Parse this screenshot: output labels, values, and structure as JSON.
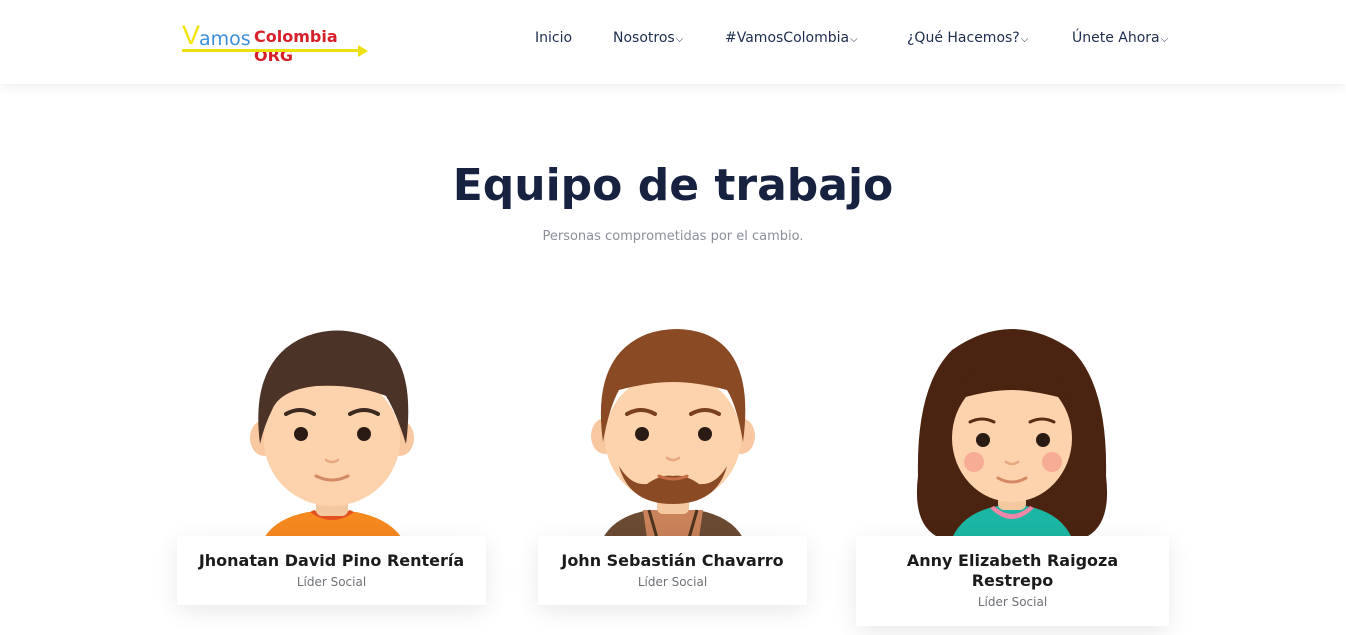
{
  "logo": {
    "part1": "V",
    "part2": "amos",
    "part3": "Colombia ORG"
  },
  "nav": {
    "items": [
      {
        "label": "Inicio",
        "dropdown": false
      },
      {
        "label": "Nosotros",
        "dropdown": true
      },
      {
        "label": "#VamosColombia",
        "dropdown": true
      },
      {
        "label": "¿Qué Hacemos?",
        "dropdown": true
      },
      {
        "label": "Únete Ahora",
        "dropdown": true
      }
    ]
  },
  "section": {
    "title": "Equipo de trabajo",
    "subtitle": "Personas comprometidas por el cambio."
  },
  "team": [
    {
      "name": "Jhonatan David Pino Rentería",
      "role": "Líder Social",
      "avatar": "boy-avatar"
    },
    {
      "name": "John Sebastián Chavarro",
      "role": "Líder Social",
      "avatar": "bearded-man-avatar"
    },
    {
      "name": "Anny Elizabeth Raigoza Restrepo",
      "role": "Líder Social",
      "avatar": "girl-avatar"
    }
  ],
  "colors": {
    "heading": "#162240",
    "nav_text": "#1f2d4d",
    "logo_yellow": "#f4e400",
    "logo_blue": "#3a8fd8",
    "logo_red": "#d8202a"
  }
}
